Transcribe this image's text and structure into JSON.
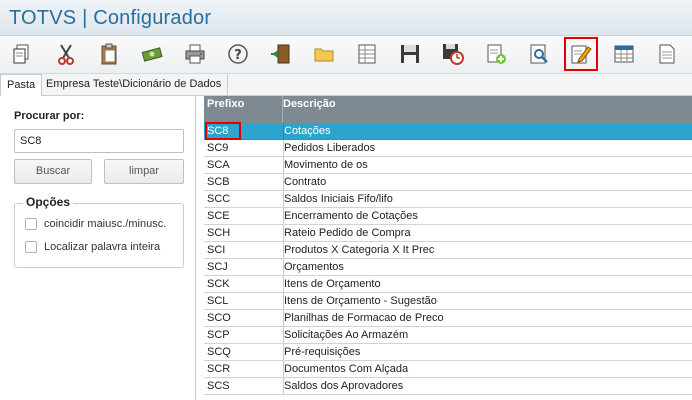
{
  "app": {
    "title": "TOTVS | Configurador"
  },
  "toolbar": {
    "buttons": [
      {
        "name": "copy-icon"
      },
      {
        "name": "cut-icon"
      },
      {
        "name": "paste-icon"
      },
      {
        "name": "money-icon"
      },
      {
        "name": "printer-icon"
      },
      {
        "name": "help-icon"
      },
      {
        "name": "exit-door-icon"
      },
      {
        "name": "folder-icon"
      },
      {
        "name": "spreadsheet-icon"
      },
      {
        "name": "save-disk-icon"
      },
      {
        "name": "save-timer-icon"
      },
      {
        "name": "new-document-icon"
      },
      {
        "name": "preview-search-icon"
      },
      {
        "name": "edit-pencil-icon"
      },
      {
        "name": "table-icon"
      },
      {
        "name": "page-icon"
      }
    ]
  },
  "tabs": [
    {
      "label": "Pasta"
    },
    {
      "label": "Empresa Teste\\Dicionário de Dados"
    }
  ],
  "search": {
    "label": "Procurar por:",
    "value": "SC8",
    "search_button": "Buscar",
    "clear_button": "limpar"
  },
  "options": {
    "title": "Opções",
    "match_case": "coincidir maiusc./minusc.",
    "whole_word": "Localizar palavra inteira"
  },
  "table": {
    "headers": [
      "Prefixo",
      "Descrição"
    ],
    "rows": [
      {
        "prefix": "SC8",
        "desc": "Cotações"
      },
      {
        "prefix": "SC9",
        "desc": "Pedidos Liberados"
      },
      {
        "prefix": "SCA",
        "desc": "Movimento de os"
      },
      {
        "prefix": "SCB",
        "desc": "Contrato"
      },
      {
        "prefix": "SCC",
        "desc": "Saldos Iniciais Fifo/lifo"
      },
      {
        "prefix": "SCE",
        "desc": "Encerramento de Cotações"
      },
      {
        "prefix": "SCH",
        "desc": "Rateio Pedido de Compra"
      },
      {
        "prefix": "SCI",
        "desc": "Produtos X Categoria X It Prec"
      },
      {
        "prefix": "SCJ",
        "desc": "Orçamentos"
      },
      {
        "prefix": "SCK",
        "desc": "Itens de Orçamento"
      },
      {
        "prefix": "SCL",
        "desc": "Itens de Orçamento - Sugestão"
      },
      {
        "prefix": "SCO",
        "desc": "Planilhas de Formacao de Preco"
      },
      {
        "prefix": "SCP",
        "desc": "Solicitações Ao Armazém"
      },
      {
        "prefix": "SCQ",
        "desc": "Pré-requisições"
      },
      {
        "prefix": "SCR",
        "desc": "Documentos Com Alçada"
      },
      {
        "prefix": "SCS",
        "desc": "Saldos dos Aprovadores"
      }
    ]
  },
  "colors": {
    "title": "#2a6f9b",
    "selected_row": "#2da4cf",
    "header_bg": "#7f8992",
    "highlight": "#e00000"
  }
}
